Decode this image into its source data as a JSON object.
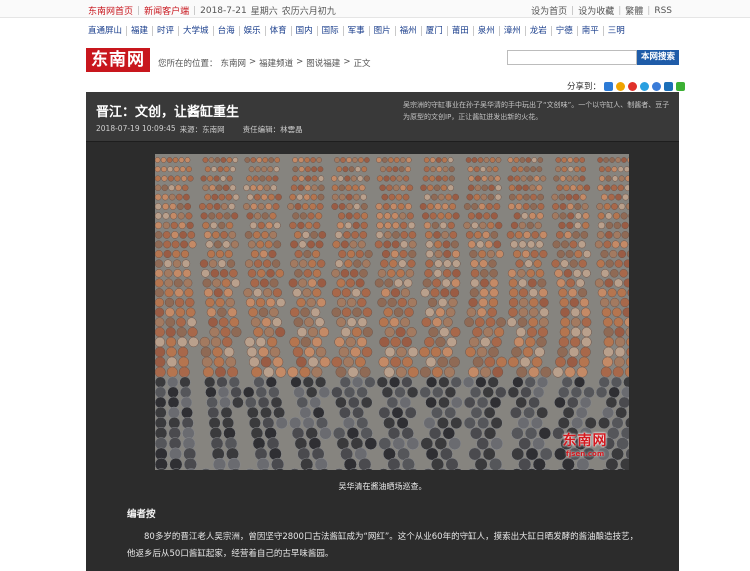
{
  "topbar": {
    "home_link": "东南网首页",
    "client_link": "新闻客户端",
    "date": "2018-7-21",
    "weekday": "星期六",
    "lunar": "农历六月初九",
    "set_home": "设为首页",
    "add_favorite": "设为收藏",
    "traditional": "繁體",
    "rss": "RSS"
  },
  "nav": {
    "items": [
      "直通屏山",
      "福建",
      "时评",
      "大学城",
      "台海",
      "娱乐",
      "体育",
      "国内",
      "国际",
      "军事",
      "图片",
      "福州",
      "厦门",
      "莆田",
      "泉州",
      "漳州",
      "龙岩",
      "宁德",
      "南平",
      "三明"
    ]
  },
  "header": {
    "logo": "东南网",
    "crumb_prefix": "您所在的位置：",
    "crumbs": [
      "东南网",
      "福建频道",
      "图说福建",
      "正文"
    ],
    "search_button": "本网搜索",
    "search_placeholder": ""
  },
  "share": {
    "label": "分享到："
  },
  "article": {
    "title": "晋江：文创，让酱缸重生",
    "datetime": "2018-07-19 10:09:45",
    "source": "来源：东南网",
    "editor": "责任编辑：林雲晶",
    "summary": "吴宗洲的守缸事业在孙子吴华清的手中玩出了“文创味”。一个以守缸人、制酱者、豆子为原型的文创IP，正让酱缸迸发出新的火花。",
    "caption": "吴华清在酱油晒场巡查。",
    "note_title": "编者按",
    "body": "80多岁的晋江老人吴宗洲，曾因坚守2800口古法酱缸成为“网红”。这个从业60年的守缸人，摸索出大缸日晒发酵的酱油酿造技艺，他返乡后从50口酱缸起家，经营着自己的古早味酱园。",
    "watermark_logo": "东南网",
    "watermark_url": "fjsen.com"
  },
  "colors": {
    "brand_red": "#c8161d",
    "nav_blue": "#1a3e8c",
    "panel_dark": "#2c2c2c"
  }
}
